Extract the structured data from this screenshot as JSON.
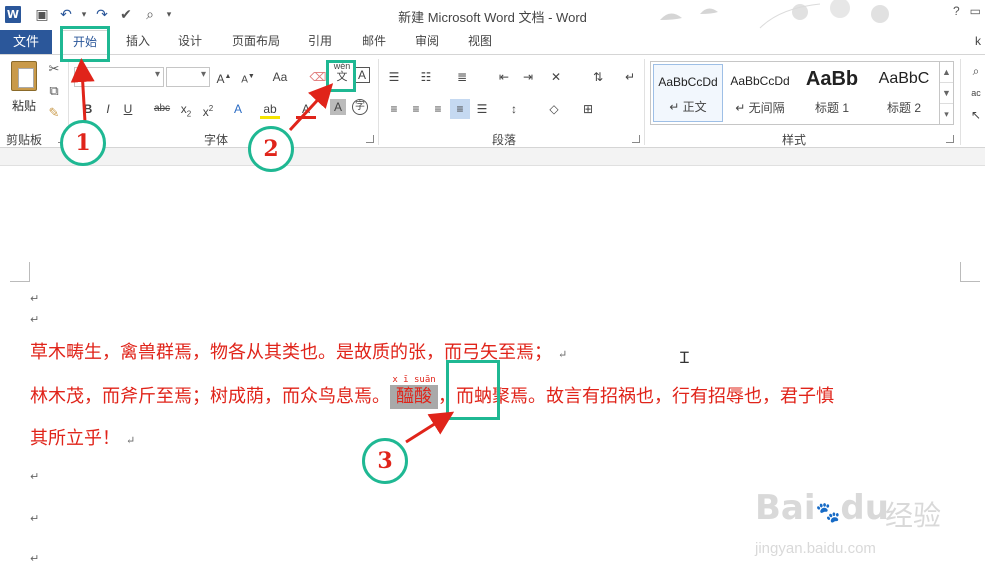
{
  "window": {
    "title": "新建 Microsoft Word 文档 - Word",
    "app_icon": "W",
    "help": "?",
    "user": "k"
  },
  "tabs": {
    "file": "文件",
    "items": [
      "开始",
      "插入",
      "设计",
      "页面布局",
      "引用",
      "邮件",
      "审阅",
      "视图"
    ]
  },
  "ribbon": {
    "clipboard": {
      "paste_label": "粘贴",
      "group_label": "剪贴板"
    },
    "font": {
      "group_label": "字体",
      "aa_label": "Aa",
      "phonetic_top": "wén",
      "phonetic_bottom": "文",
      "border_char": "A",
      "circle_char": "字"
    },
    "paragraph": {
      "group_label": "段落"
    },
    "styles": {
      "group_label": "样式",
      "items": [
        {
          "sample": "AaBbCcDd",
          "name": "↵ 正文"
        },
        {
          "sample": "AaBbCcDd",
          "name": "↵ 无间隔"
        },
        {
          "sample": "AaBb",
          "name": "标题 1"
        },
        {
          "sample": "AaBbC",
          "name": "标题 2"
        }
      ]
    }
  },
  "document": {
    "line1": "草木畴生，禽兽群焉，物各从其类也。是故质的张，而弓矢至焉；",
    "line2_before": "林木茂，而斧斤至焉；树成荫，而众鸟息焉。",
    "ruby_text": "x ī suān",
    "ruby_base": "醯酸",
    "line2_after": "，而蚋聚焉。故言有招祸也，行有招辱也，君子慎",
    "line3": "其所立乎！",
    "para_mark": "↵"
  },
  "annotations": {
    "step1": "1",
    "step2": "2",
    "step3": "3",
    "color": "#1fb893",
    "arrow_color": "#e0241a"
  },
  "watermark": {
    "brand": "Bai",
    "brand2": "du",
    "cn": "经验",
    "url": "jingyan.baidu.com"
  }
}
